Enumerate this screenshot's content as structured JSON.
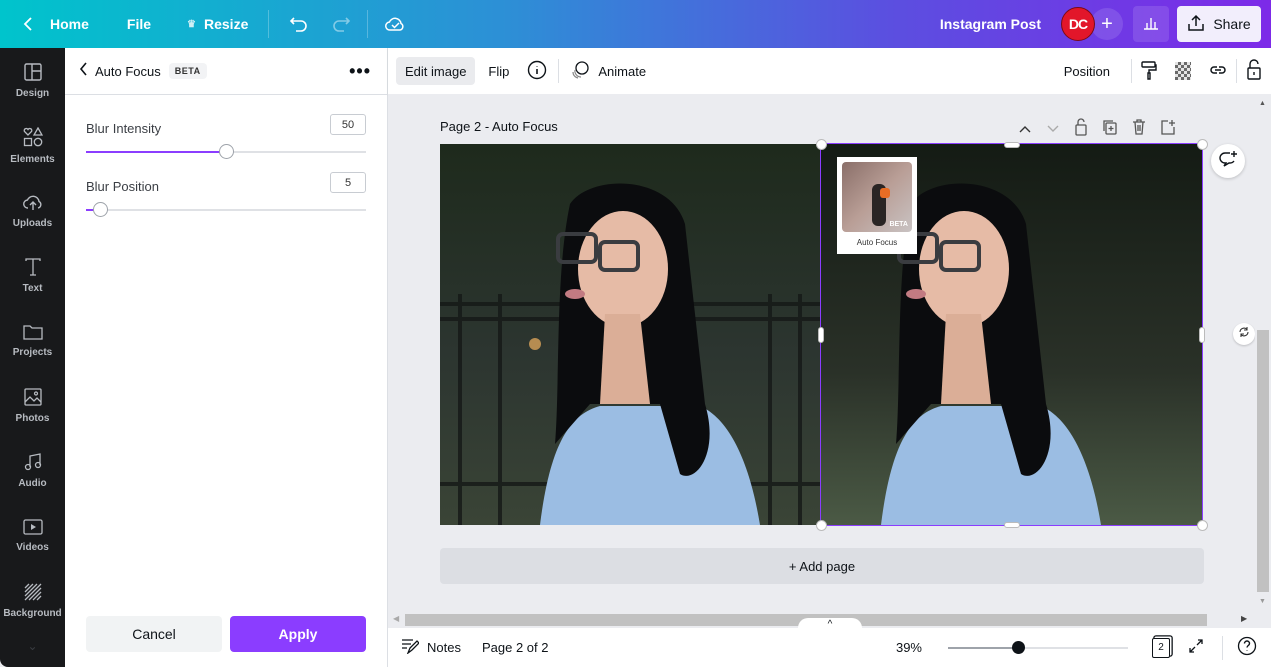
{
  "topbar": {
    "home_label": "Home",
    "file_label": "File",
    "resize_label": "Resize",
    "design_title": "Instagram Post",
    "avatar_initials": "DC",
    "share_label": "Share"
  },
  "rail": [
    {
      "label": "Design",
      "icon": "layout-icon"
    },
    {
      "label": "Elements",
      "icon": "shapes-icon"
    },
    {
      "label": "Uploads",
      "icon": "cloud-upload-icon"
    },
    {
      "label": "Text",
      "icon": "text-icon"
    },
    {
      "label": "Projects",
      "icon": "folder-icon"
    },
    {
      "label": "Photos",
      "icon": "image-icon"
    },
    {
      "label": "Audio",
      "icon": "music-icon"
    },
    {
      "label": "Videos",
      "icon": "video-icon"
    },
    {
      "label": "Background",
      "icon": "hatch-icon"
    }
  ],
  "panel": {
    "title": "Auto Focus",
    "badge": "BETA",
    "blur_intensity": {
      "label": "Blur Intensity",
      "value": "50",
      "fraction": 0.5
    },
    "blur_position": {
      "label": "Blur Position",
      "value": "5",
      "fraction": 0.05
    },
    "cancel_label": "Cancel",
    "apply_label": "Apply"
  },
  "toolbar": {
    "edit_image": "Edit image",
    "flip": "Flip",
    "animate": "Animate",
    "position": "Position"
  },
  "canvas": {
    "page_title": "Page 2 - Auto Focus",
    "app_card_label": "Auto Focus",
    "app_card_badge": "BETA",
    "add_page": "+ Add page"
  },
  "bottombar": {
    "notes": "Notes",
    "page_indicator": "Page 2 of 2",
    "zoom": "39%",
    "zoom_fraction": 0.39,
    "page_count": "2"
  },
  "colors": {
    "accent": "#8b3dff",
    "avatar": "#e2162a"
  }
}
